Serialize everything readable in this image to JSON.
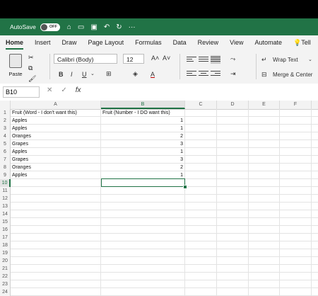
{
  "titlebar": {
    "autosave_label": "AutoSave",
    "toggle_state": "OFF",
    "more": "···"
  },
  "tabs": [
    "Home",
    "Insert",
    "Draw",
    "Page Layout",
    "Formulas",
    "Data",
    "Review",
    "View",
    "Automate",
    "Tell"
  ],
  "ribbon": {
    "paste_label": "Paste",
    "font_name": "Calibri (Body)",
    "font_size": "12",
    "grow_font": "A˄",
    "shrink_font": "A˅",
    "bold": "B",
    "italic": "I",
    "underline": "U",
    "wrap_text": "Wrap Text",
    "merge_center": "Merge & Center"
  },
  "formula_bar": {
    "name_box": "B10",
    "fx": "fx",
    "cancel": "✕",
    "enter": "✓"
  },
  "columns": [
    "A",
    "B",
    "C",
    "D",
    "E",
    "F"
  ],
  "selected_column": "B",
  "selected_row": 10,
  "row_numbers": [
    1,
    2,
    3,
    4,
    5,
    6,
    7,
    8,
    9,
    10,
    11,
    12,
    13,
    14,
    15,
    16,
    17,
    18,
    19,
    20,
    21,
    22,
    23,
    24
  ],
  "cells": [
    {
      "row": 1,
      "A": "Fruit (Word - I don't want this)",
      "B": "Fruit (Number - I DO want this)"
    },
    {
      "row": 2,
      "A": "Apples",
      "B": "1"
    },
    {
      "row": 3,
      "A": "Apples",
      "B": "1"
    },
    {
      "row": 4,
      "A": "Oranges",
      "B": "2"
    },
    {
      "row": 5,
      "A": "Grapes",
      "B": "3"
    },
    {
      "row": 6,
      "A": "Apples",
      "B": "1"
    },
    {
      "row": 7,
      "A": "Grapes",
      "B": "3"
    },
    {
      "row": 8,
      "A": "Oranges",
      "B": "2"
    },
    {
      "row": 9,
      "A": "Apples",
      "B": "1"
    }
  ],
  "colors": {
    "accent": "#217346",
    "ribbon_bg": "#f3f3f3"
  }
}
